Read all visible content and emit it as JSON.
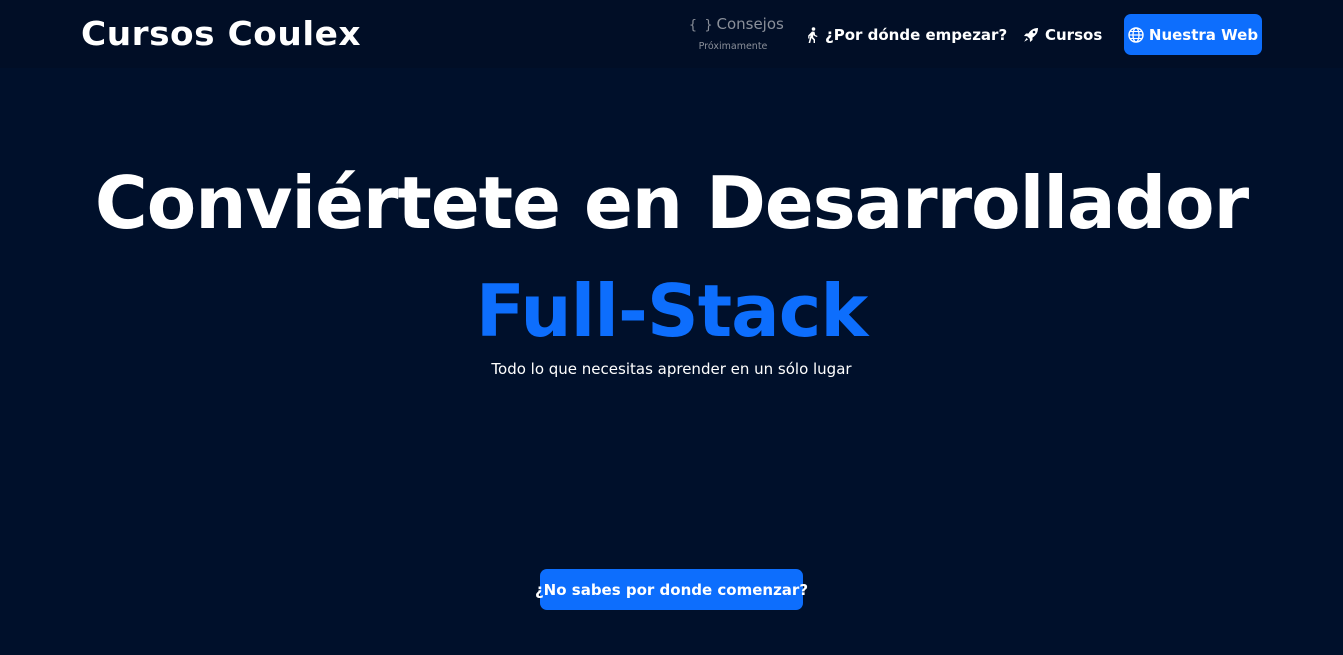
{
  "header": {
    "brand": "Cursos Coulex",
    "nav": {
      "consejos_icon": "{ }",
      "consejos_label": "Consejos",
      "consejos_note": "Próximamente",
      "empezar_icon": "person-walking-icon",
      "empezar_label": "¿Por dónde empezar?",
      "cursos_icon": "rocket-icon",
      "cursos_label": "Cursos",
      "web_icon": "globe-icon",
      "web_label": "Nuestra Web"
    }
  },
  "hero": {
    "title": "Conviértete en Desarrollador",
    "accent": "Full-Stack",
    "subtitle": "Todo lo que necesitas aprender en un sólo lugar",
    "cta_label": "¿No sabes por donde comenzar?"
  },
  "colors": {
    "background": "#00102b",
    "navbar": "#010e26",
    "accent": "#0d6efd",
    "muted": "#8a8f99"
  }
}
